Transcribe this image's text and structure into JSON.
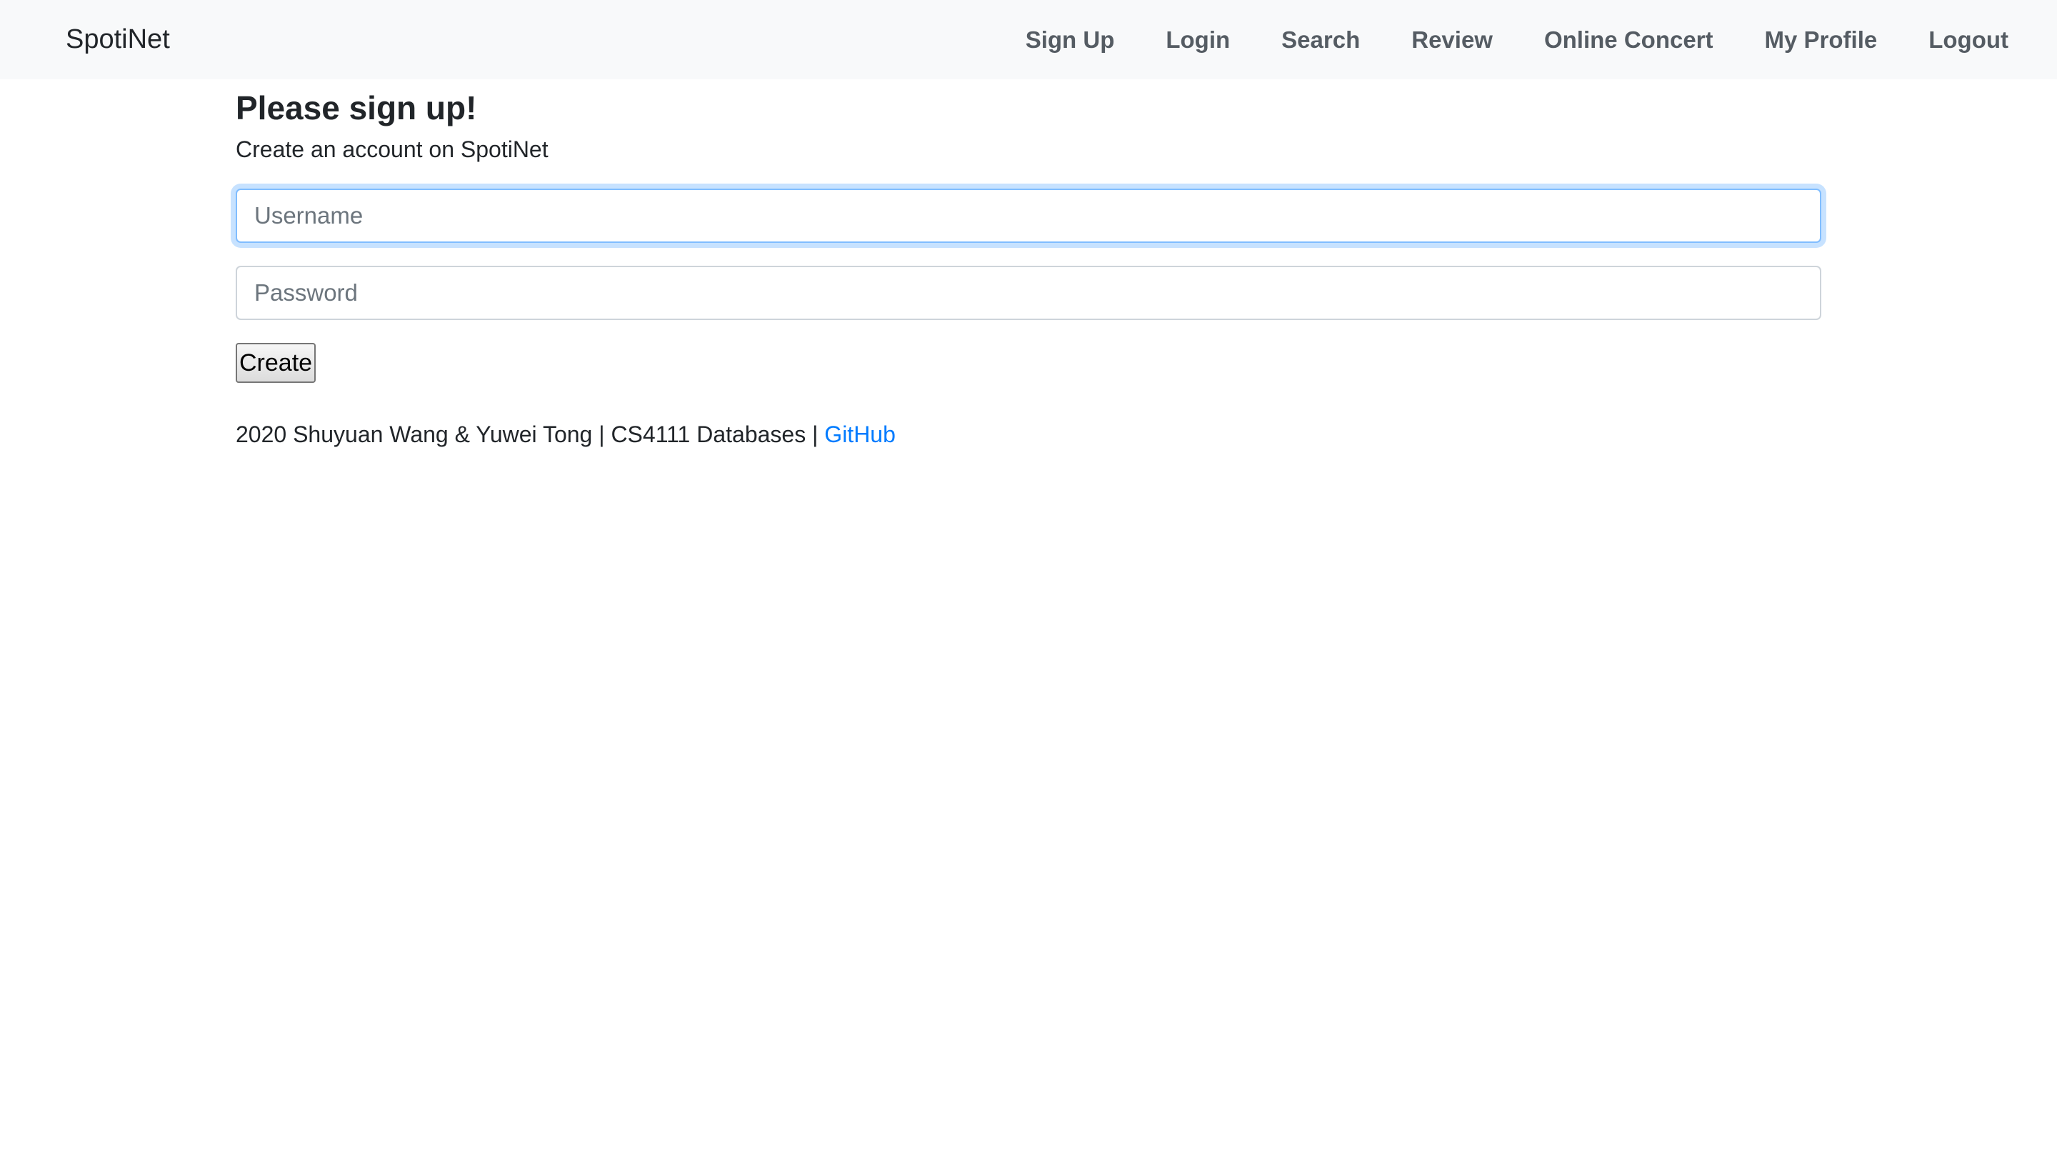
{
  "navbar": {
    "brand": "SpotiNet",
    "links": [
      {
        "label": "Sign Up"
      },
      {
        "label": "Login"
      },
      {
        "label": "Search"
      },
      {
        "label": "Review"
      },
      {
        "label": "Online Concert"
      },
      {
        "label": "My Profile"
      },
      {
        "label": "Logout"
      }
    ]
  },
  "form": {
    "title": "Please sign up!",
    "subtitle": "Create an account on SpotiNet",
    "username": {
      "value": "",
      "placeholder": "Username"
    },
    "password": {
      "value": "",
      "placeholder": "Password"
    },
    "submit_label": "Create"
  },
  "footer": {
    "text": "2020 Shuyuan Wang & Yuwei Tong | CS4111 Databases | ",
    "link_label": "GitHub"
  },
  "colors": {
    "navbar_bg": "#f8f9fa",
    "link": "#007bff",
    "focus_border": "#80bdff"
  }
}
